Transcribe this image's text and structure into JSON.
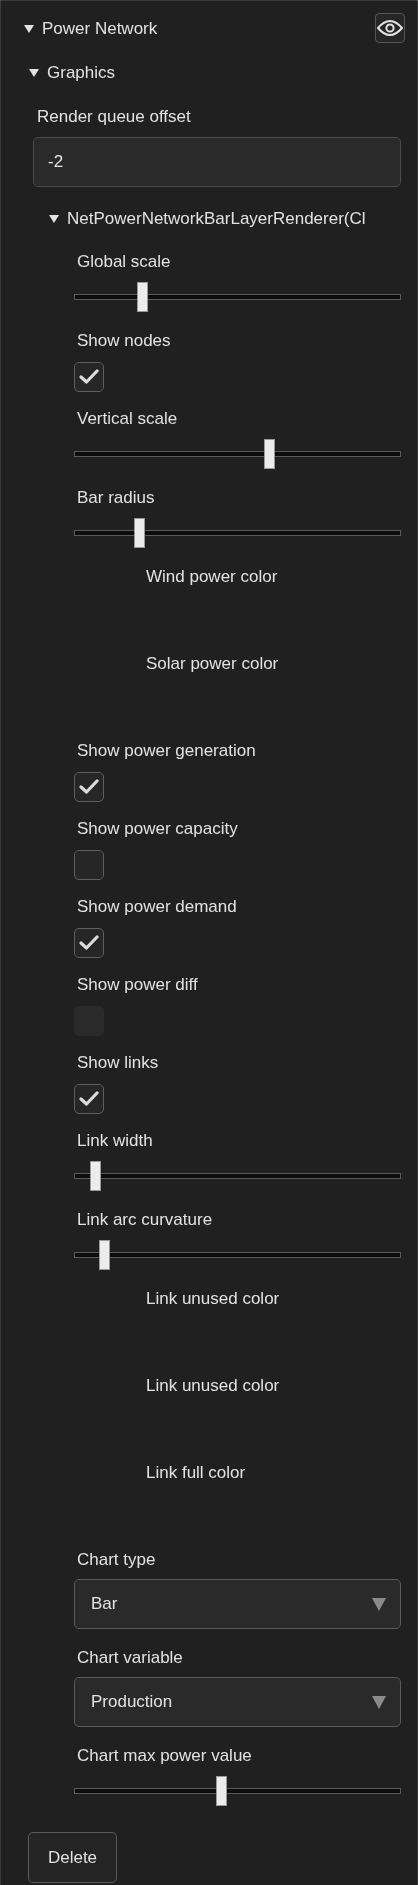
{
  "panel": {
    "title": "Power Network",
    "expanded": true,
    "section": {
      "title": "Graphics",
      "expanded": true,
      "render_queue_offset": {
        "label": "Render queue offset",
        "value": "-2"
      },
      "renderer": {
        "title": "NetPowerNetworkBarLayerRenderer(Cl",
        "expanded": true,
        "fields": [
          {
            "kind": "slider",
            "label": "Global scale",
            "level": 0.2
          },
          {
            "kind": "checkbox",
            "label": "Show nodes",
            "checked": true,
            "disabled": false
          },
          {
            "kind": "slider",
            "label": "Vertical scale",
            "level": 0.6
          },
          {
            "kind": "slider",
            "label": "Bar radius",
            "level": 0.19
          },
          {
            "kind": "color",
            "label": "Wind power color"
          },
          {
            "kind": "color",
            "label": "Solar power color"
          },
          {
            "kind": "checkbox",
            "label": "Show power generation",
            "checked": true,
            "disabled": false
          },
          {
            "kind": "checkbox",
            "label": "Show power capacity",
            "checked": false,
            "disabled": false
          },
          {
            "kind": "checkbox",
            "label": "Show power demand",
            "checked": true,
            "disabled": false
          },
          {
            "kind": "checkbox",
            "label": "Show power diff",
            "checked": false,
            "disabled": true
          },
          {
            "kind": "checkbox",
            "label": "Show links",
            "checked": true,
            "disabled": false
          },
          {
            "kind": "slider",
            "label": "Link width",
            "level": 0.05
          },
          {
            "kind": "slider",
            "label": "Link arc curvature",
            "level": 0.08
          },
          {
            "kind": "color",
            "label": "Link unused color"
          },
          {
            "kind": "color",
            "label": "Link unused color"
          },
          {
            "kind": "color",
            "label": "Link full color"
          },
          {
            "kind": "dropdown",
            "label": "Chart type",
            "value": "Bar"
          },
          {
            "kind": "dropdown",
            "label": "Chart variable",
            "value": "Production"
          },
          {
            "kind": "slider",
            "label": "Chart max power value",
            "level": 0.45
          }
        ]
      }
    }
  },
  "delete_button": "Delete"
}
